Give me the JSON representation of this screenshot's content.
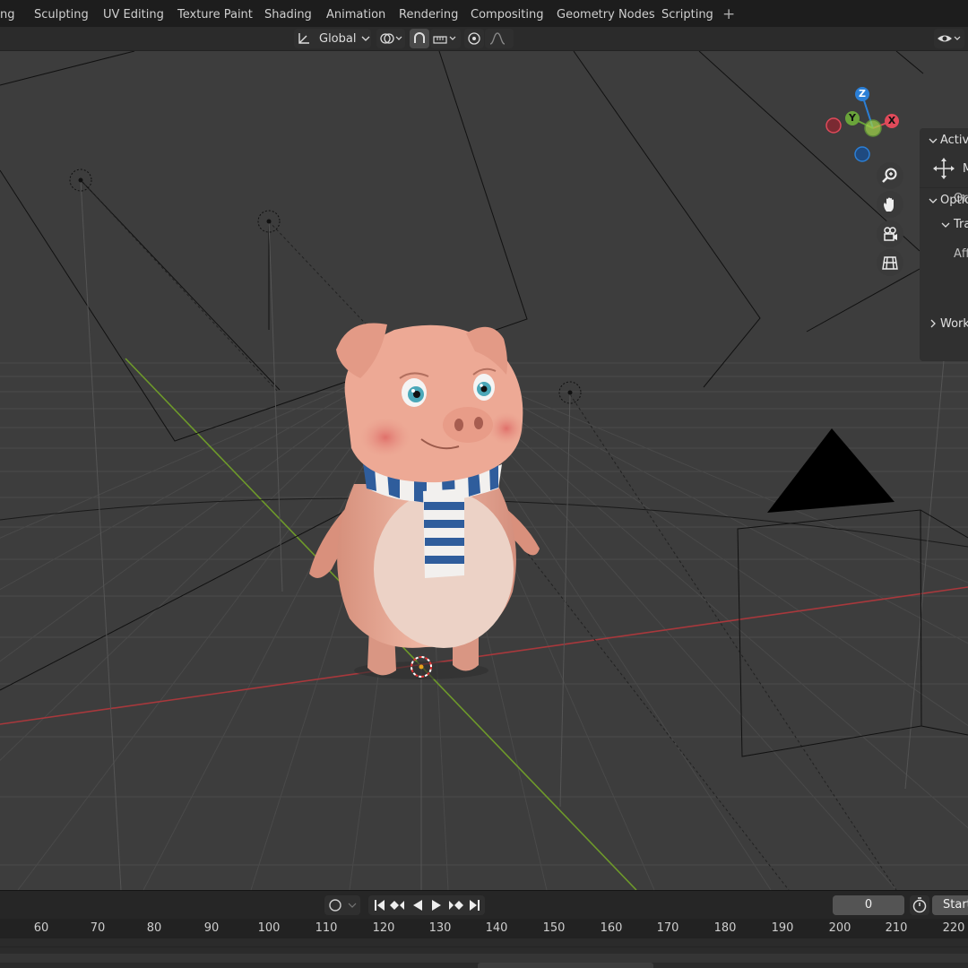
{
  "workspace_tabs": [
    "ng",
    "Sculpting",
    "UV Editing",
    "Texture Paint",
    "Shading",
    "Animation",
    "Rendering",
    "Compositing",
    "Geometry Nodes",
    "Scripting"
  ],
  "add_tab_glyph": "+",
  "header": {
    "orientation_label": "Global"
  },
  "gizmo": {
    "z_label": "Z",
    "y_label": "Y",
    "x_label": "X",
    "x_color": "#e04a5a",
    "y_color": "#6aa43a",
    "z_color": "#2b7fd6"
  },
  "npanel": {
    "active_tool": "Active",
    "move_label": "M",
    "orientation_label": "Ori",
    "options": "Optio",
    "transform": "Tra",
    "affect": "Aff",
    "workspace": "Work"
  },
  "timeline": {
    "current_frame": "0",
    "start_label": "Start",
    "ruler_ticks": [
      "60",
      "70",
      "80",
      "90",
      "100",
      "110",
      "120",
      "130",
      "140",
      "150",
      "160",
      "170",
      "180",
      "190",
      "200",
      "210",
      "220"
    ]
  },
  "icons": [
    "transform-orientation-icon",
    "snap-icon",
    "proportional-edit-icon",
    "visibility-icon",
    "zoom-icon",
    "hand-pan-icon",
    "camera-view-icon",
    "grid-ortho-icon",
    "jump-start-icon",
    "prev-keyframe-icon",
    "play-reverse-icon",
    "play-icon",
    "next-keyframe-icon",
    "jump-end-icon",
    "stopwatch-icon"
  ]
}
